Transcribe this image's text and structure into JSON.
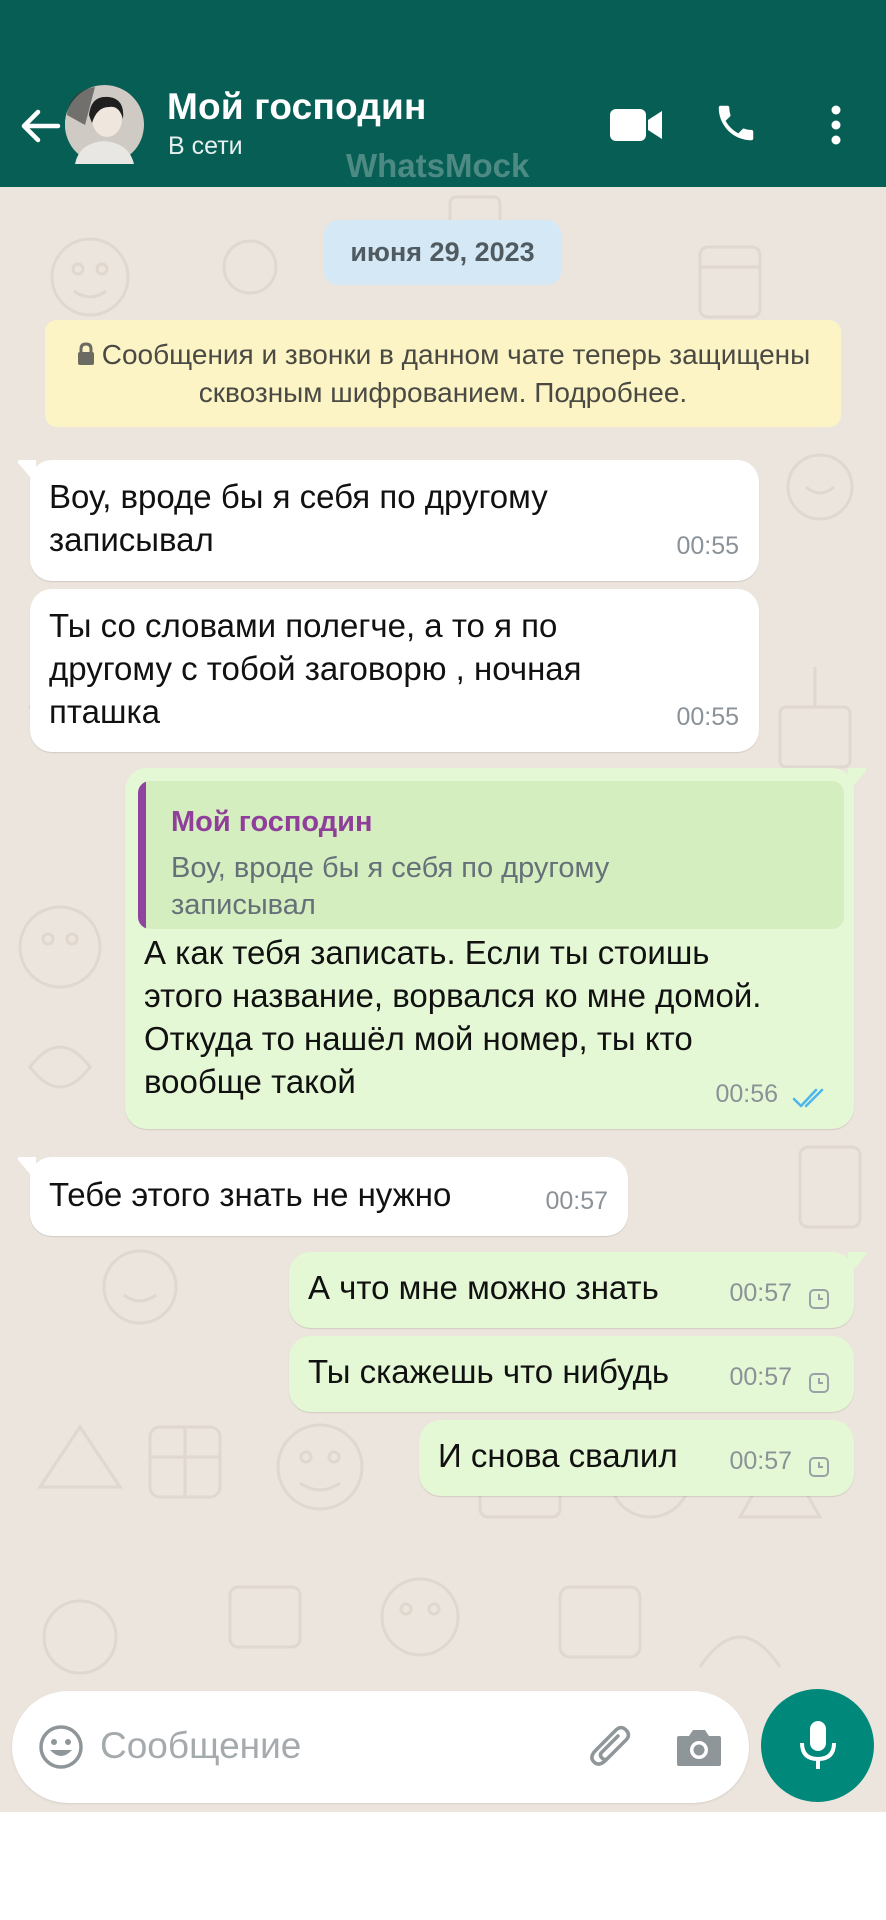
{
  "header": {
    "contact_name": "Мой господин",
    "status": "В сети",
    "watermark": "WhatsMock",
    "icons": [
      "back-arrow-icon",
      "video-call-icon",
      "phone-icon",
      "more-vert-icon"
    ]
  },
  "chat": {
    "date_label": "июня 29, 2023",
    "encryption_notice": "Сообщения и звонки в данном чате теперь защищены сквозным шифрованием. Подробнее.",
    "messages": [
      {
        "direction": "in",
        "text": "Воу, вроде бы я себя по другому\nзаписывал",
        "time": "00:55"
      },
      {
        "direction": "in",
        "text": "Ты со словами полегче, а то я по\nдругому с тобой заговорю , ночная\nпташка",
        "time": "00:55"
      },
      {
        "direction": "out",
        "quote_author": "Мой господин",
        "quote_text": "Воу, вроде бы я себя по другому\nзаписывал",
        "text": "А как тебя записать. Если ты стоишь\nэтого название, ворвался ко мне домой.\nОткуда то нашёл мой номер, ты кто\nвообще такой",
        "time": "00:56",
        "status": "read"
      },
      {
        "direction": "in",
        "text": "Тебе этого знать не нужно",
        "time": "00:57"
      },
      {
        "direction": "out",
        "text": "А что мне можно знать",
        "time": "00:57",
        "status": "pending"
      },
      {
        "direction": "out",
        "text": "Ты скажешь что нибудь",
        "time": "00:57",
        "status": "pending"
      },
      {
        "direction": "out",
        "text": "И снова свалил",
        "time": "00:57",
        "status": "pending"
      }
    ]
  },
  "composer": {
    "placeholder": "Сообщение",
    "icons": [
      "emoji-icon",
      "attach-icon",
      "camera-icon",
      "mic-icon"
    ]
  },
  "colors": {
    "header": "#075e54",
    "chat_background": "#ece5dd",
    "incoming_bubble": "#ffffff",
    "outgoing_bubble": "#e5f8d5",
    "read_ticks": "#4fb6ec",
    "mic_button": "#00897b"
  }
}
